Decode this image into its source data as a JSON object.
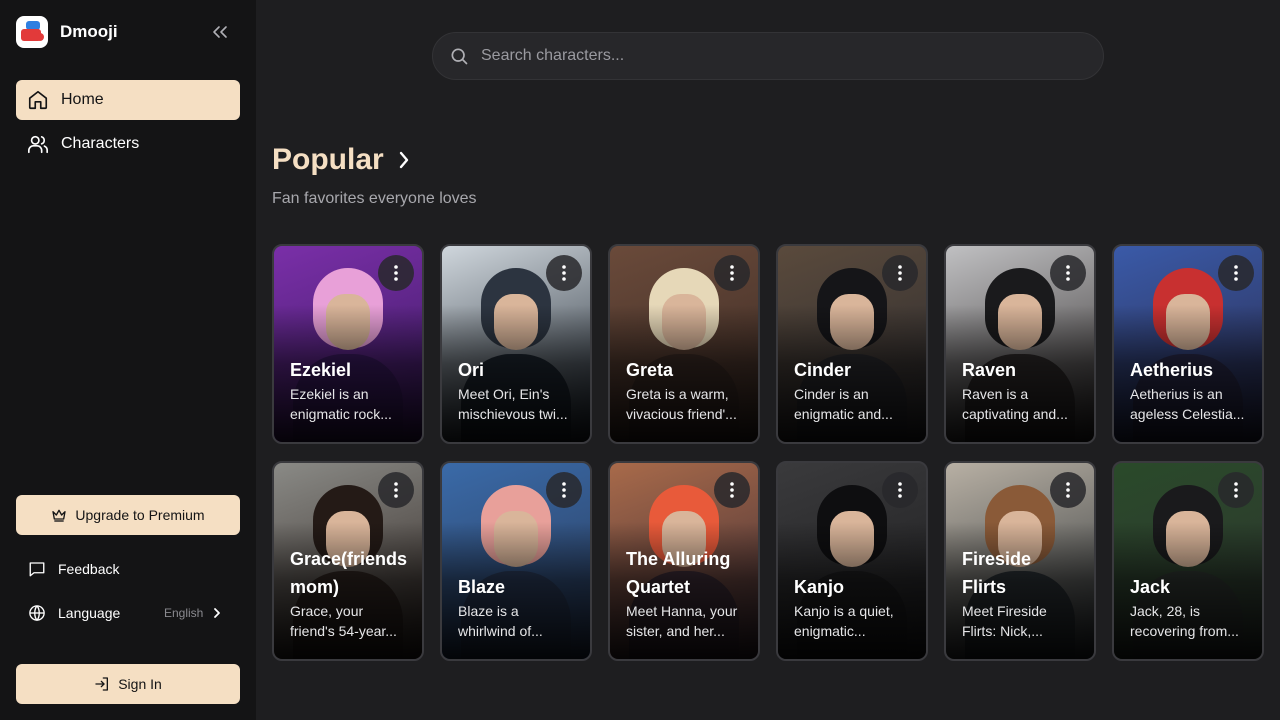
{
  "app": {
    "name": "Dmooji"
  },
  "sidebar": {
    "nav": [
      {
        "label": "Home",
        "icon": "home-icon",
        "active": true
      },
      {
        "label": "Characters",
        "icon": "users-icon",
        "active": false
      }
    ],
    "upgrade_label": "Upgrade to Premium",
    "feedback_label": "Feedback",
    "language_label": "Language",
    "language_value": "English",
    "signin_label": "Sign In"
  },
  "search": {
    "placeholder": "Search characters..."
  },
  "section": {
    "title": "Popular",
    "subtitle": "Fan favorites everyone loves"
  },
  "characters": [
    {
      "name": "Ezekiel",
      "desc_line1": "Ezekiel is an",
      "desc_line2": "enigmatic rock...",
      "colors": [
        "#7a2fa8",
        "#e8a0d8",
        "#3a1a60"
      ]
    },
    {
      "name": "Ori",
      "desc_line1": "Meet Ori, Ein's",
      "desc_line2": "mischievous twi...",
      "colors": [
        "#cfd6dc",
        "#2c3440",
        "#1d2630"
      ]
    },
    {
      "name": "Greta",
      "desc_line1": "Greta is a warm,",
      "desc_line2": "vivacious friend'...",
      "colors": [
        "#6a4a3a",
        "#e6d8b8",
        "#3a2a24"
      ]
    },
    {
      "name": "Cinder",
      "desc_line1": "Cinder is an",
      "desc_line2": "enigmatic and...",
      "colors": [
        "#5a4a3c",
        "#151518",
        "#2a2a2e"
      ]
    },
    {
      "name": "Raven",
      "desc_line1": "Raven is a",
      "desc_line2": "captivating and...",
      "colors": [
        "#c0c0c2",
        "#1a1a1c",
        "#2e2a2a"
      ]
    },
    {
      "name": "Aetherius",
      "desc_line1": "Aetherius is an",
      "desc_line2": "ageless Celestia...",
      "colors": [
        "#3a5aa8",
        "#c83030",
        "#2a2a4a"
      ]
    },
    {
      "name": "Grace(friends mom)",
      "name_line1": "Grace(friends",
      "name_line2": "mom)",
      "desc_line1": "Grace, your",
      "desc_line2": "friend's 54-year...",
      "colors": [
        "#8a8a86",
        "#241a16",
        "#2e2420"
      ]
    },
    {
      "name": "Blaze",
      "desc_line1": "Blaze is a",
      "desc_line2": "whirlwind of...",
      "colors": [
        "#3a6aa8",
        "#e8a09a",
        "#2a3a58"
      ]
    },
    {
      "name": "The Alluring Quartet",
      "name_line1": "The Alluring",
      "name_line2": "Quartet",
      "desc_line1": "Meet Hanna, your",
      "desc_line2": "sister, and her...",
      "colors": [
        "#a86a4a",
        "#e85a3a",
        "#3a2a34"
      ]
    },
    {
      "name": "Kanjo",
      "desc_line1": "Kanjo is a quiet,",
      "desc_line2": "enigmatic...",
      "colors": [
        "#3a3a3c",
        "#0e0e10",
        "#1c1c1e"
      ]
    },
    {
      "name": "Fireside Flirts",
      "name_line1": "Fireside",
      "name_line2": "Flirts",
      "desc_line1": "Meet Fireside",
      "desc_line2": "Flirts: Nick,...",
      "colors": [
        "#b8b0a4",
        "#8a5a38",
        "#2a3034"
      ]
    },
    {
      "name": "Jack",
      "desc_line1": "Jack, 28, is",
      "desc_line2": "recovering from...",
      "colors": [
        "#2a4a2a",
        "#1a1a1c",
        "#2e3430"
      ]
    }
  ],
  "colors": {
    "accent": "#f5dfc3",
    "background": "#1e1e20",
    "sidebar": "#141415"
  }
}
